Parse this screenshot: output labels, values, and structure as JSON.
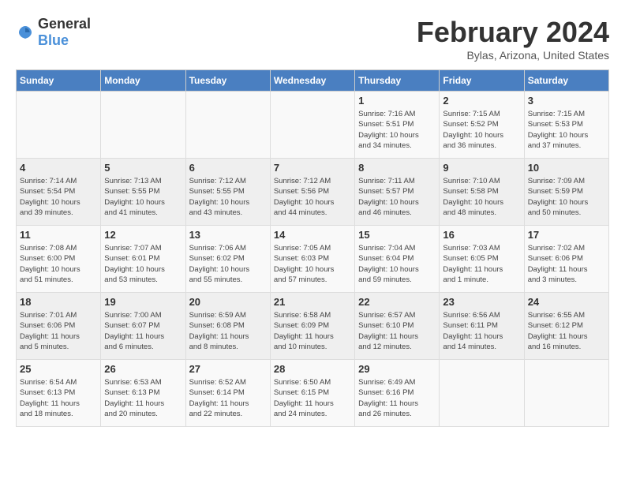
{
  "logo": {
    "general": "General",
    "blue": "Blue"
  },
  "title": "February 2024",
  "location": "Bylas, Arizona, United States",
  "days_of_week": [
    "Sunday",
    "Monday",
    "Tuesday",
    "Wednesday",
    "Thursday",
    "Friday",
    "Saturday"
  ],
  "weeks": [
    [
      {
        "day": "",
        "info": ""
      },
      {
        "day": "",
        "info": ""
      },
      {
        "day": "",
        "info": ""
      },
      {
        "day": "",
        "info": ""
      },
      {
        "day": "1",
        "info": "Sunrise: 7:16 AM\nSunset: 5:51 PM\nDaylight: 10 hours\nand 34 minutes."
      },
      {
        "day": "2",
        "info": "Sunrise: 7:15 AM\nSunset: 5:52 PM\nDaylight: 10 hours\nand 36 minutes."
      },
      {
        "day": "3",
        "info": "Sunrise: 7:15 AM\nSunset: 5:53 PM\nDaylight: 10 hours\nand 37 minutes."
      }
    ],
    [
      {
        "day": "4",
        "info": "Sunrise: 7:14 AM\nSunset: 5:54 PM\nDaylight: 10 hours\nand 39 minutes."
      },
      {
        "day": "5",
        "info": "Sunrise: 7:13 AM\nSunset: 5:55 PM\nDaylight: 10 hours\nand 41 minutes."
      },
      {
        "day": "6",
        "info": "Sunrise: 7:12 AM\nSunset: 5:55 PM\nDaylight: 10 hours\nand 43 minutes."
      },
      {
        "day": "7",
        "info": "Sunrise: 7:12 AM\nSunset: 5:56 PM\nDaylight: 10 hours\nand 44 minutes."
      },
      {
        "day": "8",
        "info": "Sunrise: 7:11 AM\nSunset: 5:57 PM\nDaylight: 10 hours\nand 46 minutes."
      },
      {
        "day": "9",
        "info": "Sunrise: 7:10 AM\nSunset: 5:58 PM\nDaylight: 10 hours\nand 48 minutes."
      },
      {
        "day": "10",
        "info": "Sunrise: 7:09 AM\nSunset: 5:59 PM\nDaylight: 10 hours\nand 50 minutes."
      }
    ],
    [
      {
        "day": "11",
        "info": "Sunrise: 7:08 AM\nSunset: 6:00 PM\nDaylight: 10 hours\nand 51 minutes."
      },
      {
        "day": "12",
        "info": "Sunrise: 7:07 AM\nSunset: 6:01 PM\nDaylight: 10 hours\nand 53 minutes."
      },
      {
        "day": "13",
        "info": "Sunrise: 7:06 AM\nSunset: 6:02 PM\nDaylight: 10 hours\nand 55 minutes."
      },
      {
        "day": "14",
        "info": "Sunrise: 7:05 AM\nSunset: 6:03 PM\nDaylight: 10 hours\nand 57 minutes."
      },
      {
        "day": "15",
        "info": "Sunrise: 7:04 AM\nSunset: 6:04 PM\nDaylight: 10 hours\nand 59 minutes."
      },
      {
        "day": "16",
        "info": "Sunrise: 7:03 AM\nSunset: 6:05 PM\nDaylight: 11 hours\nand 1 minute."
      },
      {
        "day": "17",
        "info": "Sunrise: 7:02 AM\nSunset: 6:06 PM\nDaylight: 11 hours\nand 3 minutes."
      }
    ],
    [
      {
        "day": "18",
        "info": "Sunrise: 7:01 AM\nSunset: 6:06 PM\nDaylight: 11 hours\nand 5 minutes."
      },
      {
        "day": "19",
        "info": "Sunrise: 7:00 AM\nSunset: 6:07 PM\nDaylight: 11 hours\nand 6 minutes."
      },
      {
        "day": "20",
        "info": "Sunrise: 6:59 AM\nSunset: 6:08 PM\nDaylight: 11 hours\nand 8 minutes."
      },
      {
        "day": "21",
        "info": "Sunrise: 6:58 AM\nSunset: 6:09 PM\nDaylight: 11 hours\nand 10 minutes."
      },
      {
        "day": "22",
        "info": "Sunrise: 6:57 AM\nSunset: 6:10 PM\nDaylight: 11 hours\nand 12 minutes."
      },
      {
        "day": "23",
        "info": "Sunrise: 6:56 AM\nSunset: 6:11 PM\nDaylight: 11 hours\nand 14 minutes."
      },
      {
        "day": "24",
        "info": "Sunrise: 6:55 AM\nSunset: 6:12 PM\nDaylight: 11 hours\nand 16 minutes."
      }
    ],
    [
      {
        "day": "25",
        "info": "Sunrise: 6:54 AM\nSunset: 6:13 PM\nDaylight: 11 hours\nand 18 minutes."
      },
      {
        "day": "26",
        "info": "Sunrise: 6:53 AM\nSunset: 6:13 PM\nDaylight: 11 hours\nand 20 minutes."
      },
      {
        "day": "27",
        "info": "Sunrise: 6:52 AM\nSunset: 6:14 PM\nDaylight: 11 hours\nand 22 minutes."
      },
      {
        "day": "28",
        "info": "Sunrise: 6:50 AM\nSunset: 6:15 PM\nDaylight: 11 hours\nand 24 minutes."
      },
      {
        "day": "29",
        "info": "Sunrise: 6:49 AM\nSunset: 6:16 PM\nDaylight: 11 hours\nand 26 minutes."
      },
      {
        "day": "",
        "info": ""
      },
      {
        "day": "",
        "info": ""
      }
    ]
  ]
}
